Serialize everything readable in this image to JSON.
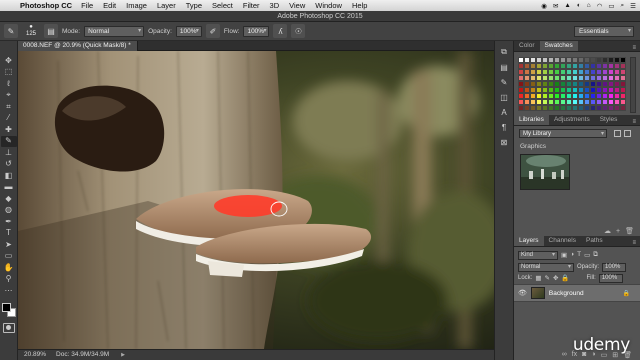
{
  "menubar": {
    "app_name": "Photoshop CC",
    "items": [
      "File",
      "Edit",
      "Image",
      "Layer",
      "Type",
      "Select",
      "Filter",
      "3D",
      "View",
      "Window",
      "Help"
    ]
  },
  "window_title": "Adobe Photoshop CC 2015",
  "options_bar": {
    "brush_size": "125",
    "mode_label": "Mode:",
    "mode_value": "Normal",
    "opacity_label": "Opacity:",
    "opacity_value": "100%",
    "flow_label": "Flow:",
    "flow_value": "100%",
    "workspace": "Essentials"
  },
  "document": {
    "tab_label": "0008.NEF @ 20.9% (Quick Mask/8) *",
    "zoom": "20.89%",
    "doc_size": "Doc: 34.9M/34.9M"
  },
  "panels": {
    "color_tabs": [
      "Color",
      "Swatches"
    ],
    "library_tabs": [
      "Libraries",
      "Adjustments",
      "Styles"
    ],
    "library_name": "My Library",
    "library_section": "Graphics",
    "layer_tabs": [
      "Layers",
      "Channels",
      "Paths"
    ],
    "kind_filter": "Kind",
    "blend_mode": "Normal",
    "opacity_label": "Opacity:",
    "opacity_value": "100%",
    "lock_label": "Lock:",
    "fill_label": "Fill:",
    "fill_value": "100%",
    "layer_name": "Background"
  },
  "watermark": "udemy",
  "colors": {
    "menubar": "#e2e2e2",
    "panel": "#535353",
    "quick_mask_overlay": "#ff3c2a"
  },
  "icons": [
    "apple-icon",
    "brush-icon",
    "airbrush-icon",
    "pressure-icon",
    "eye-icon",
    "lock-icon"
  ]
}
